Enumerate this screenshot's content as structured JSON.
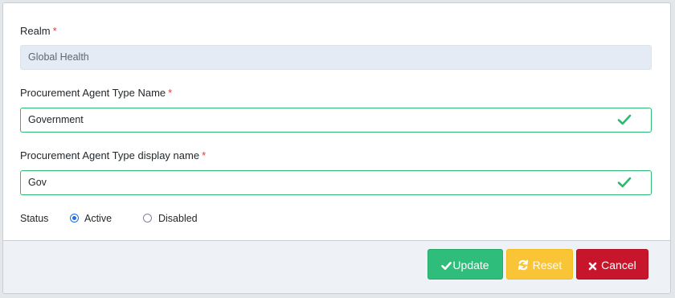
{
  "form": {
    "realm": {
      "label": "Realm",
      "required_mark": "*",
      "value": "Global Health"
    },
    "type_name": {
      "label": "Procurement Agent Type Name",
      "required_mark": "*",
      "value": "Government"
    },
    "display_name": {
      "label": "Procurement Agent Type display name",
      "required_mark": "*",
      "value": "Gov"
    },
    "status": {
      "label": "Status",
      "options": [
        {
          "label": "Active",
          "selected": true
        },
        {
          "label": "Disabled",
          "selected": false
        }
      ]
    }
  },
  "footer": {
    "update_label": "Update",
    "reset_label": "Reset",
    "cancel_label": "Cancel"
  },
  "colors": {
    "valid": "#2eb872",
    "update": "#2ebd7a",
    "reset": "#f9c536",
    "cancel": "#c7162b",
    "radio": "#1f6fde"
  },
  "icons": {
    "field_valid": "check-icon",
    "update": "check-icon",
    "reset": "refresh-icon",
    "cancel": "close-icon"
  }
}
